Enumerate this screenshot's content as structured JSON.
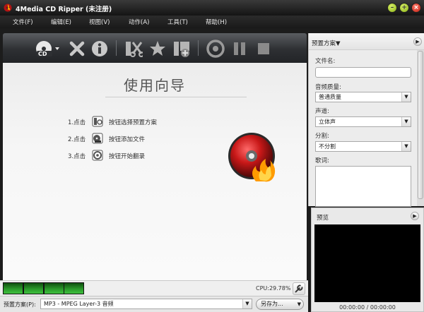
{
  "window": {
    "title": "4Media CD Ripper (未注册)",
    "controls": {
      "min": "–",
      "max": "+",
      "close": "×"
    }
  },
  "menu": [
    "文件(F)",
    "编辑(E)",
    "视图(V)",
    "动作(A)",
    "工具(T)",
    "帮助(H)"
  ],
  "toolbar": {
    "icons": [
      "load-cd-icon",
      "remove-icon",
      "info-icon",
      "cut-icon",
      "effect-icon",
      "add-segment-icon",
      "convert-icon",
      "pause-icon",
      "stop-icon"
    ]
  },
  "guide": {
    "title": "使用向导",
    "steps": [
      {
        "num": "1.点击",
        "desc": "按钮选择预置方案",
        "icon": "preset-icon"
      },
      {
        "num": "2.点击",
        "desc": "按钮添加文件",
        "icon": "add-file-icon"
      },
      {
        "num": "3.点击",
        "desc": "按钮开始翻录",
        "icon": "start-rip-icon"
      }
    ]
  },
  "status": {
    "cpu": "CPU:29.78%"
  },
  "preset_bar": {
    "label": "预置方案(P):",
    "value": "MP3 - MPEG Layer-3 音频",
    "save_as": "另存为..."
  },
  "right_panel": {
    "title": "预置方案▼",
    "filename_label": "文件名:",
    "filename_value": "",
    "quality_label": "音频质量:",
    "quality_value": "普通质量",
    "channel_label": "声道:",
    "channel_value": "立体声",
    "split_label": "分割:",
    "split_value": "不分割",
    "lyrics_label": "歌词:"
  },
  "preview": {
    "label": "预览",
    "time": "00:00:00 / 00:00:00"
  },
  "colors": {
    "accent_green": "#3fc13f",
    "disc_red": "#c81818"
  }
}
